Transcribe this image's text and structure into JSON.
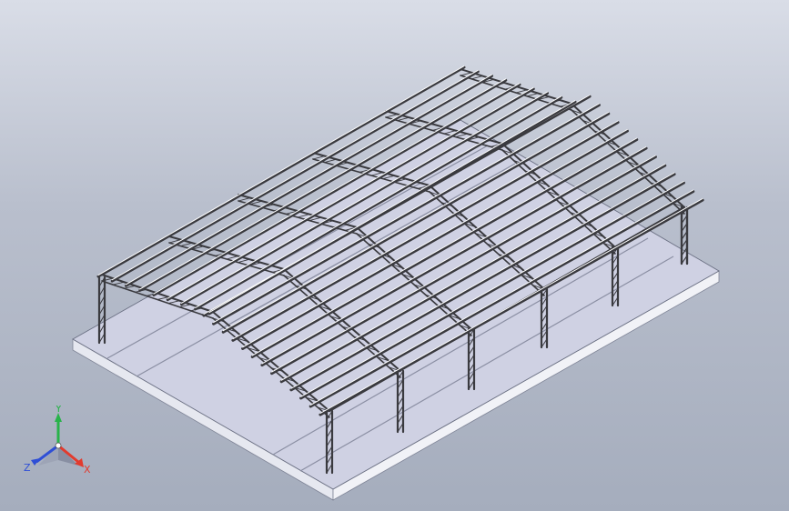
{
  "viewport": {
    "background_top": "#d9dde7",
    "background_bottom": "#a5adbd"
  },
  "model": {
    "description_colors": {
      "slab_top": "#cfd1e3",
      "slab_edge": "#ffffff",
      "slab_side": "#eceef4",
      "steel": "#3a3a3f",
      "steel_light": "#ffffff"
    }
  },
  "triad": {
    "labels": {
      "x": "X",
      "y": "Y",
      "z": "Z"
    },
    "colors": {
      "x": "#e23b2e",
      "y": "#28b34a",
      "z": "#2f4fd6"
    }
  }
}
